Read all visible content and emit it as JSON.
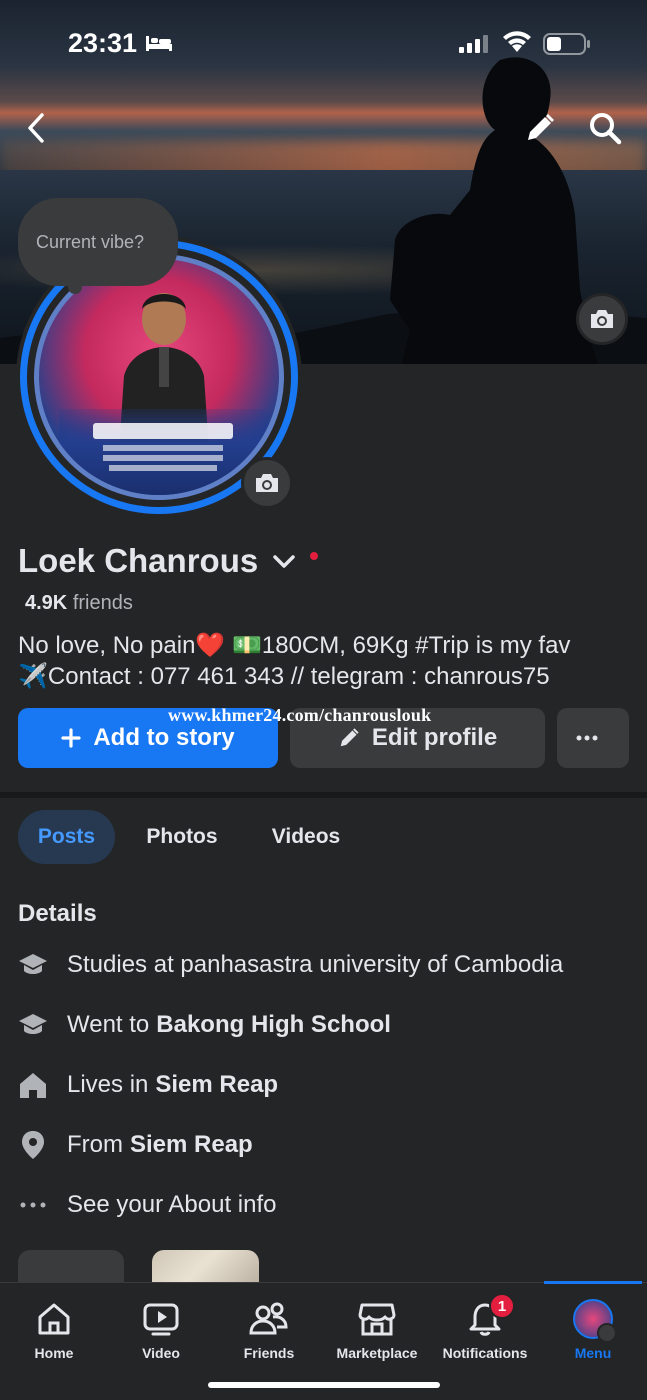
{
  "status_bar": {
    "time": "23:31"
  },
  "cover": {
    "vibe_prompt": "Current vibe?"
  },
  "profile": {
    "name": "Loek Chanrous",
    "friends_count": "4.9K",
    "friends_label": "friends",
    "bio_line1": "No love, No pain❤️ 💵180CM, 69Kg #Trip is my fav",
    "bio_line2": "✈️Contact : 077 461 343 // telegram : chanrous75",
    "watermark": "www.khmer24.com/chanrouslouk"
  },
  "actions": {
    "add_story_label": "Add to story",
    "edit_profile_label": "Edit profile",
    "more_label": "···"
  },
  "tabs": [
    {
      "label": "Posts"
    },
    {
      "label": "Photos"
    },
    {
      "label": "Videos"
    }
  ],
  "details": {
    "title": "Details",
    "items": [
      {
        "prefix": "Studies at panhasastra university of Cambodia",
        "bold": "",
        "icon": "graduation-cap-icon"
      },
      {
        "prefix": "Went to",
        "bold": "Bakong High School",
        "icon": "graduation-cap-icon"
      },
      {
        "prefix": "Lives in",
        "bold": "Siem Reap",
        "icon": "home-icon"
      },
      {
        "prefix": "From",
        "bold": "Siem Reap",
        "icon": "location-pin-icon"
      },
      {
        "prefix": "See your About info",
        "bold": "",
        "icon": "more-dots-icon"
      }
    ]
  },
  "bottom_nav": [
    {
      "label": "Home",
      "icon": "home-icon"
    },
    {
      "label": "Video",
      "icon": "video-icon"
    },
    {
      "label": "Friends",
      "icon": "friends-icon"
    },
    {
      "label": "Marketplace",
      "icon": "marketplace-icon"
    },
    {
      "label": "Notifications",
      "icon": "bell-icon",
      "badge": "1"
    },
    {
      "label": "Menu",
      "icon": "menu-avatar",
      "active": true
    }
  ],
  "colors": {
    "accent": "#1877f2",
    "background": "#242526",
    "badge": "#e41e3f"
  }
}
